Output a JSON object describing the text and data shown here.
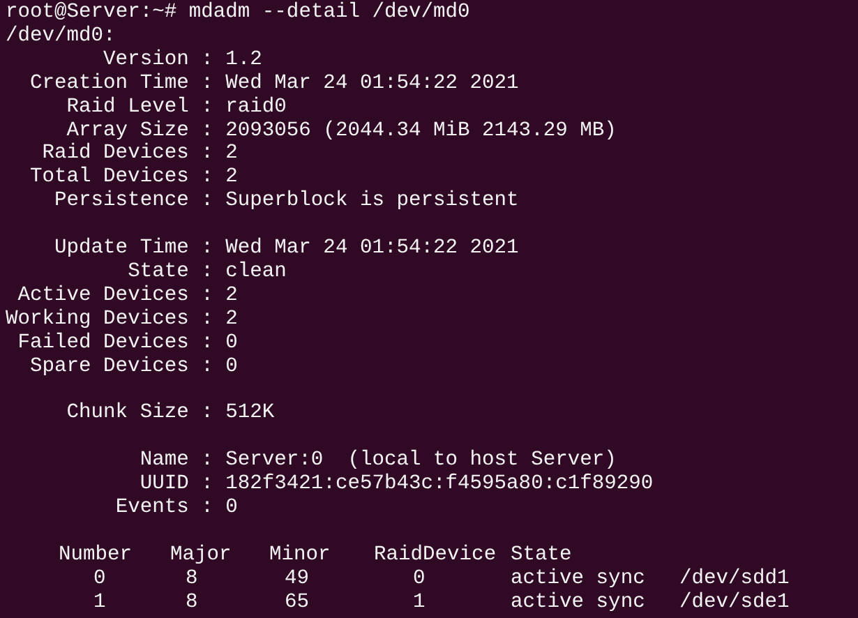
{
  "prompt": "root@Server:~#",
  "command": "mdadm --detail /dev/md0",
  "device_header": "/dev/md0:",
  "sections": [
    {
      "fields": [
        {
          "label": "Version",
          "separator": ":",
          "value": "1.2"
        },
        {
          "label": "Creation Time",
          "separator": ":",
          "value": "Wed Mar 24 01:54:22 2021"
        },
        {
          "label": "Raid Level",
          "separator": ":",
          "value": "raid0"
        },
        {
          "label": "Array Size",
          "separator": ":",
          "value": "2093056 (2044.34 MiB 2143.29 MB)"
        },
        {
          "label": "Raid Devices",
          "separator": ":",
          "value": "2"
        },
        {
          "label": "Total Devices",
          "separator": ":",
          "value": "2"
        },
        {
          "label": "Persistence",
          "separator": ":",
          "value": "Superblock is persistent"
        }
      ]
    },
    {
      "fields": [
        {
          "label": "Update Time",
          "separator": ":",
          "value": "Wed Mar 24 01:54:22 2021"
        },
        {
          "label": "State",
          "separator": ":",
          "value": "clean"
        },
        {
          "label": "Active Devices",
          "separator": ":",
          "value": "2"
        },
        {
          "label": "Working Devices",
          "separator": ":",
          "value": "2"
        },
        {
          "label": "Failed Devices",
          "separator": ":",
          "value": "0"
        },
        {
          "label": "Spare Devices",
          "separator": ":",
          "value": "0"
        }
      ]
    },
    {
      "fields": [
        {
          "label": "Chunk Size",
          "separator": ":",
          "value": "512K"
        }
      ]
    },
    {
      "fields": [
        {
          "label": "Name",
          "separator": ":",
          "value": "Server:0  (local to host Server)"
        },
        {
          "label": "UUID",
          "separator": ":",
          "value": "182f3421:ce57b43c:f4595a80:c1f89290"
        },
        {
          "label": "Events",
          "separator": ":",
          "value": "0"
        }
      ]
    }
  ],
  "device_table": {
    "columns": [
      "Number",
      "Major",
      "Minor",
      "RaidDevice",
      "State"
    ],
    "rows": [
      {
        "cells": [
          "0",
          "8",
          "49",
          "0",
          "active sync",
          "/dev/sdd1"
        ]
      },
      {
        "cells": [
          "1",
          "8",
          "65",
          "1",
          "active sync",
          "/dev/sde1"
        ]
      }
    ]
  }
}
